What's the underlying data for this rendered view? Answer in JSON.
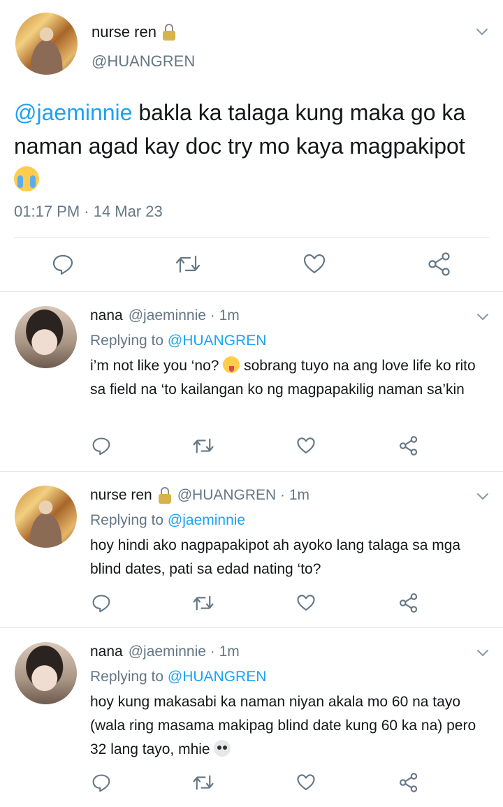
{
  "main_tweet": {
    "display_name": "nurse ren",
    "handle": "@HUANGREN",
    "text_mention": "@jaeminnie",
    "text_body": " bakla ka talaga kung maka go ka naman agad kay doc try mo kaya magpakipot ",
    "timestamp": "01:17 PM · 14 Mar 23",
    "icons": [
      "reply-icon",
      "retweet-icon",
      "like-icon",
      "share-icon"
    ]
  },
  "replies": [
    {
      "display_name": "nana",
      "meta": "@jaeminnie · 1m",
      "replying_prefix": "Replying to ",
      "replying_to": "@HUANGREN",
      "text_before_emoji": "i’m not like you ‘no? ",
      "emoji": "tongue-emoji",
      "text_after_emoji": " sobrang tuyo na ang love life ko rito sa field na ‘to kailangan ko ng magpapakilig naman sa’kin"
    },
    {
      "display_name": "nurse ren",
      "meta": "@HUANGREN · 1m",
      "replying_prefix": "Replying to ",
      "replying_to": "@jaeminnie",
      "text": "hoy hindi ako nagpapakipot ah ayoko lang talaga sa mga blind dates, pati sa edad nating ‘to?"
    },
    {
      "display_name": "nana",
      "meta": "@jaeminnie · 1m",
      "replying_prefix": "Replying to ",
      "replying_to": "@HUANGREN",
      "text": "hoy kung makasabi ka naman niyan akala mo 60 na tayo (wala ring masama makipag blind date kung 60 ka na) pero 32 lang tayo, mhie ",
      "emoji": "skull-emoji"
    }
  ],
  "colors": {
    "link": "#1da1f2",
    "secondary": "#657786",
    "text": "#14171a",
    "divider": "#e1e8ed"
  }
}
